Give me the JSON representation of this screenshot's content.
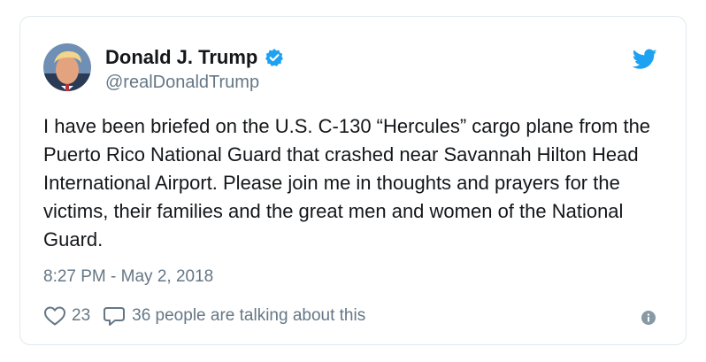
{
  "author": {
    "name": "Donald J. Trump",
    "handle": "@realDonaldTrump",
    "verified": true
  },
  "tweet": {
    "text": "I have been briefed on the U.S. C-130 “Hercules” cargo plane from the Puerto Rico National Guard that crashed near Savannah Hilton Head International Airport. Please join me in thoughts and prayers for the victims, their families and the great men and women of the National Guard.",
    "timestamp": "8:27 PM - May 2, 2018"
  },
  "engagement": {
    "likes": "23",
    "talking": "36 people are talking about this"
  },
  "icons": {
    "brand": "twitter-bird-icon",
    "verified": "verified-badge-icon",
    "like": "heart-icon",
    "reply": "speech-bubble-icon",
    "info": "info-icon"
  },
  "colors": {
    "brand": "#1da1f2",
    "text": "#14171a",
    "secondary": "#657786",
    "border": "#e1e8ed"
  }
}
